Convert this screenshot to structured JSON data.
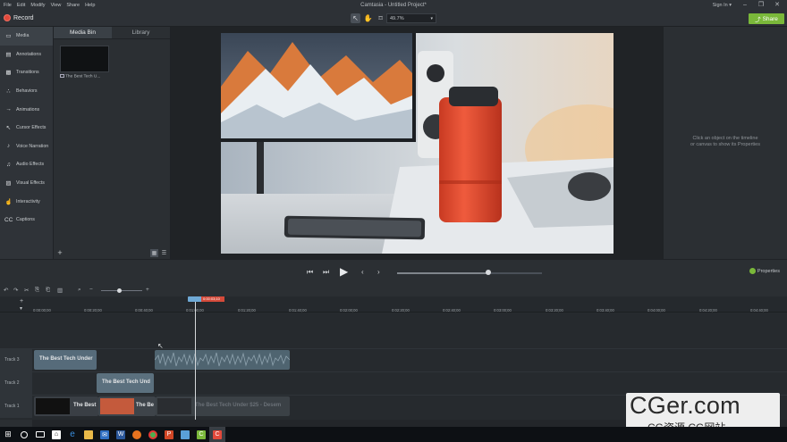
{
  "menu": [
    "File",
    "Edit",
    "Modify",
    "View",
    "Share",
    "Help"
  ],
  "window_title": "Camtasia - Untitled Project*",
  "sign_in": "Sign In ▾",
  "window_controls": [
    "–",
    "❐",
    "✕"
  ],
  "toolbar": {
    "record_label": "Record",
    "tools": [
      "pointer-tool-icon",
      "pan-tool-icon",
      "crop-tool-icon"
    ],
    "zoom_value": "49.7%",
    "share_label": "Share"
  },
  "sidebar": {
    "items": [
      {
        "label": "Media",
        "icon": "▭"
      },
      {
        "label": "Annotations",
        "icon": "▤"
      },
      {
        "label": "Transitions",
        "icon": "▩"
      },
      {
        "label": "Behaviors",
        "icon": "∴"
      },
      {
        "label": "Animations",
        "icon": "→"
      },
      {
        "label": "Cursor Effects",
        "icon": "↖"
      },
      {
        "label": "Voice Narration",
        "icon": "♪"
      },
      {
        "label": "Audio Effects",
        "icon": "♫"
      },
      {
        "label": "Visual Effects",
        "icon": "▨"
      },
      {
        "label": "Interactivity",
        "icon": "☝"
      },
      {
        "label": "Captions",
        "icon": "CC"
      }
    ]
  },
  "media_bin": {
    "tabs": [
      "Media Bin",
      "Library"
    ],
    "thumb_caption": "The Best Tech U...",
    "add": "+"
  },
  "properties_hint": {
    "line1": "Click an object on the timeline",
    "line2": "or canvas to show its Properties"
  },
  "playback": {
    "properties_label": "Properties",
    "scrub_fraction": 0.63
  },
  "timeline": {
    "playhead_time": "0:00:03;10",
    "ticks": [
      "0:00:00;00",
      "0:00:20;00",
      "0:00:40;00",
      "0:01:00;00",
      "0:01:20;00",
      "0:01:40;00",
      "0:02:00;00",
      "0:02:20;00",
      "0:02:40;00",
      "0:03:00;00",
      "0:03:20;00",
      "0:03:40;00",
      "0:04:00;00",
      "0:04:20;00",
      "0:04:40;00"
    ],
    "tracks": [
      {
        "name": "Track 3",
        "clips": [
          {
            "label": "The Best Tech Under"
          },
          {
            "label": ""
          }
        ]
      },
      {
        "name": "Track 2",
        "clips": [
          {
            "label": "The Best Tech Und"
          }
        ]
      },
      {
        "name": "Track 1",
        "clips": [
          {
            "label": "The Best"
          },
          {
            "label": "The Be"
          },
          {
            "label": "The Best Tech Under $25 - Desem"
          }
        ]
      }
    ]
  },
  "watermark": {
    "line1": "CGer.com",
    "line2": "CG资源 CG网站"
  },
  "taskbar": {
    "icons": [
      "windows-start-icon",
      "search-icon",
      "task-view-icon",
      "store-icon",
      "edge-icon",
      "explorer-icon",
      "mail-icon",
      "word-icon",
      "firefox-icon",
      "chrome-icon",
      "powerpoint-icon",
      "app-icon",
      "camtasia-recorder-icon",
      "camtasia-icon"
    ]
  }
}
